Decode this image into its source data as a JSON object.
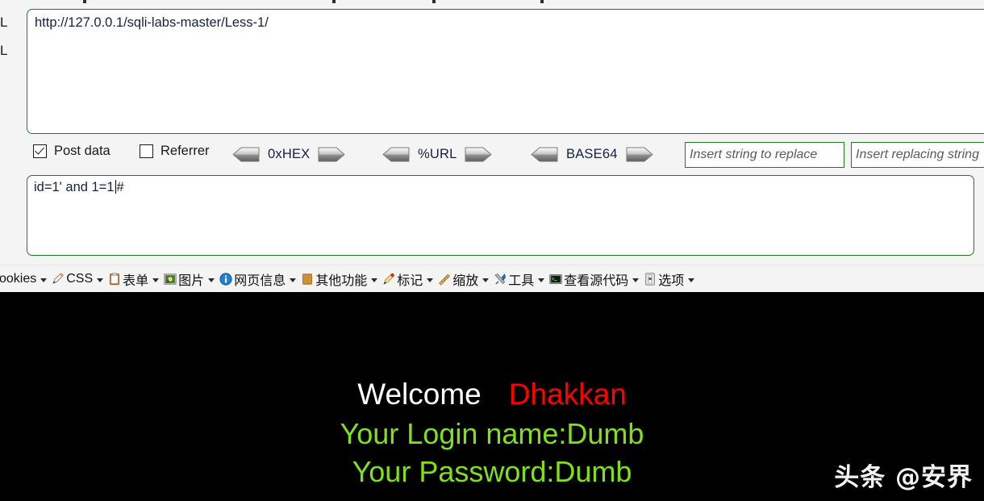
{
  "hackbar": {
    "edge_labels": [
      "L",
      "L"
    ],
    "url_field": {
      "value": "http://127.0.0.1/sqli-labs-master/Less-1/",
      "placeholder": ""
    },
    "post_field": {
      "value_before_caret": "id=1' and 1=1",
      "value_after_caret": "#",
      "full_value": "id=1' and 1=1#",
      "placeholder": ""
    },
    "checkboxes": [
      {
        "label": "Post data",
        "checked": true
      },
      {
        "label": "Referrer",
        "checked": false
      }
    ],
    "encoders": [
      {
        "label": "0xHEX"
      },
      {
        "label": "%URL"
      },
      {
        "label": "BASE64"
      }
    ],
    "replace_inputs": [
      {
        "placeholder": "Insert string to replace",
        "value": ""
      },
      {
        "placeholder": "Insert replacing string",
        "value": ""
      }
    ],
    "colors": {
      "field_border": "#1f7a1f",
      "chrome_bg": "#f4f4f4"
    }
  },
  "devtoolbar": {
    "items": [
      {
        "label": "ookies",
        "icon": "cookie-icon",
        "has_menu": true,
        "clipped": true
      },
      {
        "label": "CSS",
        "icon": "pencil-css-icon",
        "has_menu": true
      },
      {
        "label": "表单",
        "icon": "clipboard-icon",
        "has_menu": true
      },
      {
        "label": "图片",
        "icon": "picture-icon",
        "has_menu": true
      },
      {
        "label": "网页信息",
        "icon": "info-circle-icon",
        "has_menu": true
      },
      {
        "label": "其他功能",
        "icon": "book-icon",
        "has_menu": true
      },
      {
        "label": "标记",
        "icon": "pencil-red-icon",
        "has_menu": true
      },
      {
        "label": "缩放",
        "icon": "ruler-icon",
        "has_menu": true
      },
      {
        "label": "工具",
        "icon": "wrench-screwdriver-icon",
        "has_menu": true
      },
      {
        "label": "查看源代码",
        "icon": "terminal-icon",
        "has_menu": true
      },
      {
        "label": "选项",
        "icon": "options-icon",
        "has_menu": true
      }
    ]
  },
  "page": {
    "background": "#000000",
    "welcome_word": "Welcome",
    "welcome_user": "Dhakkan",
    "login_line": "Your Login name:Dumb",
    "password_line": "Your Password:Dumb",
    "watermark": "头条 @安界",
    "colors": {
      "welcome": "#ffffff",
      "user": "#ff0000",
      "credentials": "#80e01a"
    }
  }
}
